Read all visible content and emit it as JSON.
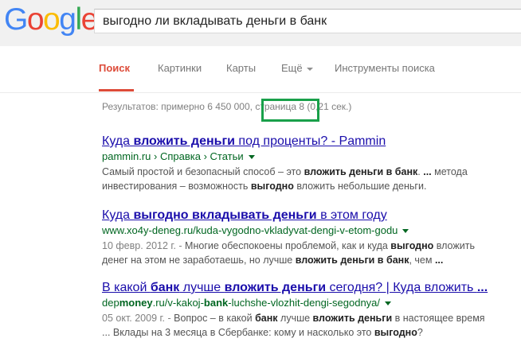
{
  "logo": {
    "letters": [
      "G",
      "o",
      "o",
      "g",
      "l",
      "e"
    ],
    "colors": [
      "#4285f4",
      "#ea4335",
      "#fbbc05",
      "#4285f4",
      "#34a853",
      "#ea4335"
    ]
  },
  "search": {
    "query": "выгодно ли вкладывать деньги в банк"
  },
  "tabs": {
    "search": "Поиск",
    "images": "Картинки",
    "maps": "Карты",
    "more": "Ещё",
    "tools": "Инструменты поиска"
  },
  "stats": {
    "prefix": "Результатов: примерно 6 450 000, ",
    "page": "страница 8",
    "suffix": " (0,21 сек.)"
  },
  "results": [
    {
      "title": [
        {
          "t": "Куда ",
          "b": false
        },
        {
          "t": "вложить деньги",
          "b": true
        },
        {
          "t": " под проценты? - Pammin",
          "b": false
        }
      ],
      "url": [
        {
          "t": "pammin.ru › Справка › Статьи",
          "b": false
        }
      ],
      "lines": [
        [
          {
            "t": "Самый простой и безопасный способ – это ",
            "b": false
          },
          {
            "t": "вложить деньги в банк",
            "b": true
          },
          {
            "t": ". ",
            "b": false
          },
          {
            "t": "...",
            "b": true
          },
          {
            "t": " метода",
            "b": false
          }
        ],
        [
          {
            "t": "инвестирования – возможность ",
            "b": false
          },
          {
            "t": "выгодно",
            "b": true
          },
          {
            "t": " вложить небольшие деньги.",
            "b": false
          }
        ]
      ]
    },
    {
      "title": [
        {
          "t": "Куда ",
          "b": false
        },
        {
          "t": "выгодно вкладывать деньги",
          "b": true
        },
        {
          "t": " в этом году",
          "b": false
        }
      ],
      "url": [
        {
          "t": "www.xo4y-deneg.ru/kuda-vygodno-vkladyvat-dengi-v-etom-godu",
          "b": false
        }
      ],
      "date": "10 февр. 2012 г. - ",
      "lines": [
        [
          {
            "t": "Многие обеспокоены проблемой, как и куда ",
            "b": false
          },
          {
            "t": "выгодно",
            "b": true
          },
          {
            "t": " вложить",
            "b": false
          }
        ],
        [
          {
            "t": "денег на этом не заработаешь, но лучше ",
            "b": false
          },
          {
            "t": "вложить деньги в банк",
            "b": true
          },
          {
            "t": ", чем ",
            "b": false
          },
          {
            "t": "...",
            "b": true
          }
        ]
      ]
    },
    {
      "title": [
        {
          "t": "В какой ",
          "b": false
        },
        {
          "t": "банк",
          "b": true
        },
        {
          "t": " лучше ",
          "b": false
        },
        {
          "t": "вложить деньги",
          "b": true
        },
        {
          "t": " сегодня? | Куда вложить ",
          "b": false
        },
        {
          "t": "...",
          "b": true
        }
      ],
      "url": [
        {
          "t": "dep",
          "b": false
        },
        {
          "t": "money",
          "b": true
        },
        {
          "t": ".ru/v-kakoj-",
          "b": false
        },
        {
          "t": "bank",
          "b": true
        },
        {
          "t": "-luchshe-vlozhit-dengi-segodnya/",
          "b": false
        }
      ],
      "date": "05 окт. 2009 г. - ",
      "lines": [
        [
          {
            "t": "Вопрос – в какой ",
            "b": false
          },
          {
            "t": "банк",
            "b": true
          },
          {
            "t": " лучше ",
            "b": false
          },
          {
            "t": "вложить деньги",
            "b": true
          },
          {
            "t": " в настоящее время",
            "b": false
          }
        ],
        [
          {
            "t": "... Вклады на 3 месяца в Сбербанке: кому и насколько это ",
            "b": false
          },
          {
            "t": "выгодно",
            "b": true
          },
          {
            "t": "?",
            "b": false
          }
        ]
      ]
    }
  ]
}
